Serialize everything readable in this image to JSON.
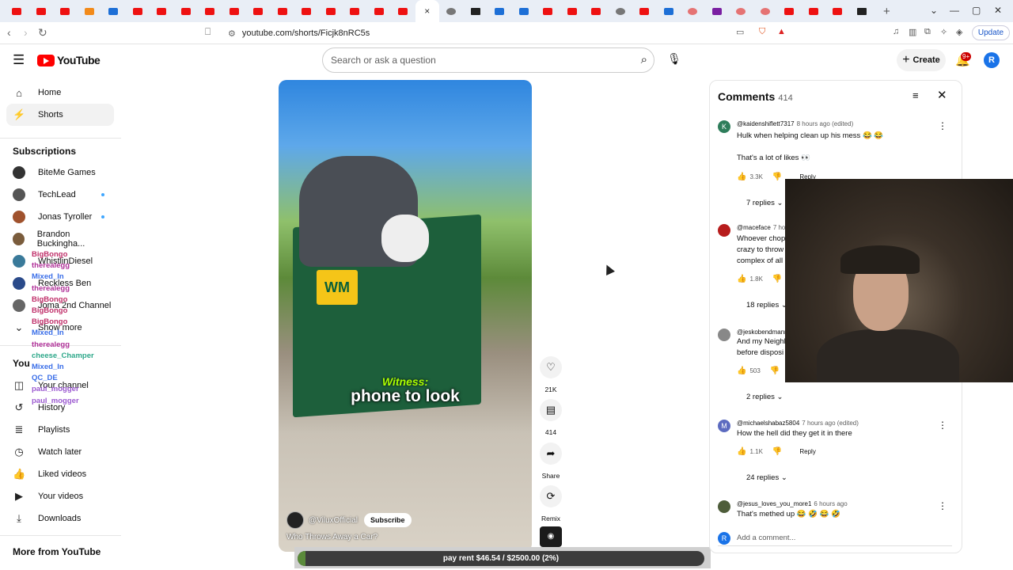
{
  "browser": {
    "url": "youtube.com/shorts/Ficjk8nRC5s",
    "update_label": "Update",
    "tabs": [
      "youtube",
      "youtube",
      "youtube",
      "reddit",
      "steam",
      "youtube",
      "youtube",
      "youtube",
      "youtube",
      "youtube",
      "youtube",
      "youtube",
      "youtube",
      "youtube",
      "youtube",
      "youtube",
      "youtube",
      "active",
      "calendar",
      "x",
      "ai",
      "ai",
      "youtube",
      "youtube",
      "youtube",
      "globe",
      "youtube",
      "steam",
      "pocket",
      "twitch",
      "pocket",
      "pocket",
      "youtube",
      "youtube",
      "youtube",
      "x"
    ],
    "close_tab_glyph": "×",
    "new_tab_glyph": "+"
  },
  "header": {
    "brand": "YouTube",
    "search_placeholder": "Search or ask a question",
    "create_label": "Create",
    "notif_badge": "9+",
    "avatar_letter": "R"
  },
  "sidebar": {
    "main": [
      {
        "label": "Home",
        "icon": "home-icon"
      },
      {
        "label": "Shorts",
        "icon": "shorts-icon"
      }
    ],
    "subscriptions_label": "Subscriptions",
    "subscriptions": [
      {
        "label": "BiteMe Games",
        "live": false
      },
      {
        "label": "TechLead",
        "live": true
      },
      {
        "label": "Jonas Tyroller",
        "live": true
      },
      {
        "label": "Brandon Buckingha...",
        "live": false
      },
      {
        "label": "WhistlinDiesel",
        "live": false
      },
      {
        "label": "Reckless Ben",
        "live": false
      },
      {
        "label": "Joma 2nd Channel",
        "live": false
      }
    ],
    "show_more_label": "Show more",
    "you_label": "You",
    "you_items": [
      "Your channel",
      "History",
      "Playlists",
      "Watch later",
      "Liked videos",
      "Your videos",
      "Downloads"
    ],
    "more_label": "More from YouTube"
  },
  "chat_overlay": [
    {
      "user": "BigBongo",
      "color": "#c0306a"
    },
    {
      "user": "therealegg",
      "color": "#b03098"
    },
    {
      "user": "Mixed_In",
      "color": "#3a6ee8"
    },
    {
      "user": "therealegg",
      "color": "#b03098"
    },
    {
      "user": "BigBongo",
      "color": "#c0306a"
    },
    {
      "user": "BigBongo",
      "color": "#c0306a"
    },
    {
      "user": "BigBongo",
      "color": "#c0306a"
    },
    {
      "user": "Mixed_In",
      "color": "#3a6ee8"
    },
    {
      "user": "therealegg",
      "color": "#b03098"
    },
    {
      "user": "cheese_Champer",
      "color": "#2ea88a"
    },
    {
      "user": "Mixed_In",
      "color": "#3a6ee8"
    },
    {
      "user": "QC_DE",
      "color": "#3a6ee8"
    },
    {
      "user": "paul_mogger",
      "color": "#9b59d0"
    },
    {
      "user": "paul_mogger",
      "color": "#9b59d0"
    }
  ],
  "video": {
    "caption_small": "Witness:",
    "caption_main": "phone to look",
    "logo_text": "WM",
    "channel": "@ViluxOfficial",
    "subscribe_label": "Subscribe",
    "title": "Who Throws Away a Car?"
  },
  "actions": [
    {
      "name": "like",
      "label": "21K",
      "icon": "heart-icon",
      "glyph": "♡"
    },
    {
      "name": "comments",
      "label": "414",
      "icon": "comment-icon",
      "glyph": "▤"
    },
    {
      "name": "share",
      "label": "Share",
      "icon": "share-icon",
      "glyph": "➦"
    },
    {
      "name": "remix",
      "label": "Remix",
      "icon": "remix-icon",
      "glyph": "⟳"
    }
  ],
  "goal": {
    "text": "pay rent $46.54 / $2500.00 (2%)",
    "fraction": 0.02
  },
  "comments_panel": {
    "title": "Comments",
    "count": "414",
    "items": [
      {
        "avatar": "K",
        "color": "#2e7d5b",
        "user": "@kaidenshiflett7317",
        "meta": "8 hours ago (edited)",
        "text": "Hulk when helping clean up his mess 😂 😂",
        "text2": "That's a lot of likes 👀",
        "likes": "3.3K",
        "reply": "Reply",
        "replies": "7 replies"
      },
      {
        "avatar": "",
        "color": "#b71c1c",
        "user": "@maceface",
        "meta": "7 ho",
        "text": "Whoever chopp",
        "text2": "crazy to throw",
        "text3": "complex of all",
        "likes": "1.8K",
        "replies": "18 replies"
      },
      {
        "avatar": "",
        "color": "#888888",
        "user": "@jeskobendmann",
        "meta": "",
        "text": "And my Neighb",
        "text2": "before disposi",
        "likes": "503",
        "replies": "2 replies"
      },
      {
        "avatar": "M",
        "color": "#5c6bc0",
        "user": "@michaelshabaz5804",
        "meta": "7 hours ago (edited)",
        "text": "How the hell did they get it in there",
        "likes": "1.1K",
        "reply": "Reply",
        "replies": "24 replies"
      },
      {
        "avatar": "",
        "color": "#4e5d3a",
        "user": "@jesus_loves_you_more1",
        "meta": "6 hours ago",
        "text": "That's methed up 😂 🤣 😂 🤣"
      }
    ],
    "add_placeholder": "Add a comment...",
    "add_avatar": "R"
  }
}
